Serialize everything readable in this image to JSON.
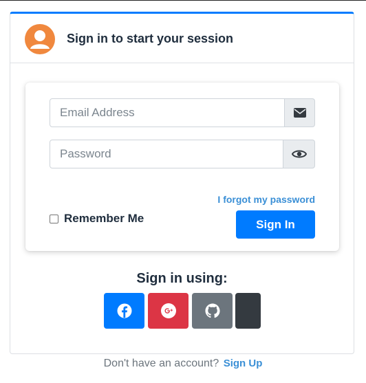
{
  "header": {
    "title": "Sign in to start your session",
    "avatar_icon": "user-avatar-icon",
    "accent_color": "#f0883e"
  },
  "login": {
    "email_placeholder": "Email Address",
    "email_value": "",
    "email_icon": "envelope-icon",
    "password_placeholder": "Password",
    "password_value": "",
    "password_icon": "eye-icon",
    "forgot_label": "I forgot my password",
    "remember_label": "Remember Me",
    "remember_checked": false,
    "signin_label": "Sign In",
    "primary_color": "#007bff"
  },
  "social": {
    "title": "Sign in using:",
    "buttons": [
      {
        "icon": "facebook-icon",
        "color": "#007bff"
      },
      {
        "icon": "google-plus-icon",
        "color": "#dc3545"
      },
      {
        "icon": "github-icon",
        "color": "#6c757d"
      },
      {
        "icon": "",
        "color": "#343a40"
      }
    ]
  },
  "footer": {
    "prompt": "Don't have an account?",
    "signup_label": "Sign Up"
  }
}
